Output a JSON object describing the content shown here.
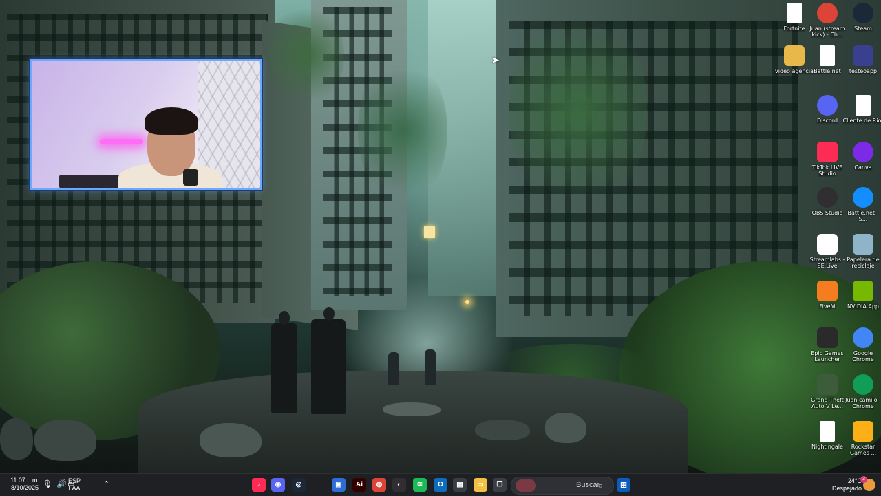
{
  "desktop": {
    "icons": [
      {
        "label": "Steam",
        "icon": "steam-icon",
        "color": "#1b2838"
      },
      {
        "label": "Juan (stream kick) - Ch...",
        "icon": "chrome-icon",
        "color": "#db4437"
      },
      {
        "label": "Fortnite",
        "icon": "file-icon",
        "color": "#ffffff"
      },
      {
        "label": "testeoapp",
        "icon": "app-icon",
        "color": "#3b3f8f"
      },
      {
        "label": "Battle.net",
        "icon": "file-icon",
        "color": "#ffffff"
      },
      {
        "label": "video agencia",
        "icon": "folder-icon",
        "color": "#e8b84a"
      },
      {
        "label": "Cliente de Riot",
        "icon": "file-icon",
        "color": "#ffffff"
      },
      {
        "label": "Discord",
        "icon": "discord-icon",
        "color": "#5865f2"
      },
      {
        "label": "Canva",
        "icon": "canva-icon",
        "color": "#7d2ae8"
      },
      {
        "label": "TikTok LIVE Studio",
        "icon": "tiktok-icon",
        "color": "#fe2c55"
      },
      {
        "label": "Battle.net - S...",
        "icon": "battlenet-icon",
        "color": "#148eff"
      },
      {
        "label": "OBS Studio",
        "icon": "obs-icon",
        "color": "#302e31"
      },
      {
        "label": "Papelera de reciclaje",
        "icon": "recycle-bin-icon",
        "color": "#8fb3c7"
      },
      {
        "label": "Streamlabs - SE.Live",
        "icon": "streamelements-icon",
        "color": "#ffffff"
      },
      {
        "label": "NVIDIA App",
        "icon": "nvidia-icon",
        "color": "#76b900"
      },
      {
        "label": "FiveM",
        "icon": "fivem-icon",
        "color": "#f57c1f"
      },
      {
        "label": "Google Chrome",
        "icon": "chrome-icon",
        "color": "#4285f4"
      },
      {
        "label": "Epic Games Launcher",
        "icon": "epic-games-icon",
        "color": "#2a2a2a"
      },
      {
        "label": "Juan camilo - Chrome",
        "icon": "chrome-icon",
        "color": "#0f9d58"
      },
      {
        "label": "Grand Theft Auto V Le...",
        "icon": "gta-icon",
        "color": "#3d5c3a"
      },
      {
        "label": "Rockstar Games ...",
        "icon": "rockstar-icon",
        "color": "#fcaf17"
      },
      {
        "label": "Nightingale",
        "icon": "file-icon",
        "color": "#ffffff"
      }
    ]
  },
  "taskbar": {
    "weather_temp": "24°C",
    "weather_desc": "Despejado",
    "search_placeholder": "Buscar",
    "time": "11:07 p.m.",
    "date": "8/10/2025",
    "lang_top": "ESP",
    "lang_bottom": "LAA",
    "badge_count": "3",
    "apps": [
      {
        "name": "tiktok-taskbar-icon",
        "color": "#fe2c55",
        "glyph": "♪"
      },
      {
        "name": "discord-taskbar-icon",
        "color": "#5865f2",
        "glyph": "◉"
      },
      {
        "name": "steam-taskbar-icon",
        "color": "#1b2838",
        "glyph": "◎"
      },
      {
        "name": "photos-taskbar-icon",
        "color": "#2c6ed6",
        "glyph": "▣"
      },
      {
        "name": "illustrator-taskbar-icon",
        "color": "#330000",
        "glyph": "Ai"
      },
      {
        "name": "chrome-taskbar-icon",
        "color": "#db4437",
        "glyph": "◍"
      },
      {
        "name": "obs-taskbar-icon",
        "color": "#302e31",
        "glyph": "◐"
      },
      {
        "name": "spotify-taskbar-icon",
        "color": "#1db954",
        "glyph": "≋"
      },
      {
        "name": "outlook-taskbar-icon",
        "color": "#0f6cbd",
        "glyph": "O"
      },
      {
        "name": "store-taskbar-icon",
        "color": "#3a3d43",
        "glyph": "▦"
      },
      {
        "name": "file-explorer-taskbar-icon",
        "color": "#f3c042",
        "glyph": "▭"
      },
      {
        "name": "task-view-taskbar-icon",
        "color": "#3a3d43",
        "glyph": "❐"
      }
    ]
  }
}
